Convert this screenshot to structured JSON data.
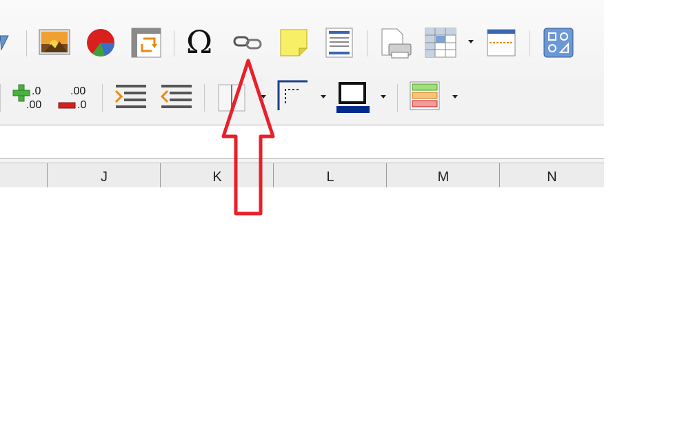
{
  "toolbar_standard": {
    "icons": [
      "image-icon",
      "chart-icon",
      "pivot-table-icon",
      "special-character-icon",
      "hyperlink-icon",
      "comment-icon",
      "headers-footers-icon",
      "print-preview-icon",
      "freeze-rows-columns-icon",
      "define-print-area-icon",
      "sidebar-icon"
    ]
  },
  "toolbar_formatting": {
    "add_decimal": {
      "top": ".0",
      "bottom": ".00"
    },
    "delete_decimal": {
      "top": ".00",
      "bottom": ".0"
    }
  },
  "column_headers": [
    "J",
    "K",
    "L",
    "M",
    "N"
  ],
  "annotation": {
    "color": "#e8202a",
    "shape": "arrow-up"
  },
  "colors": {
    "accent_blue": "#4a78b8",
    "border_blue": "#002b8c"
  }
}
